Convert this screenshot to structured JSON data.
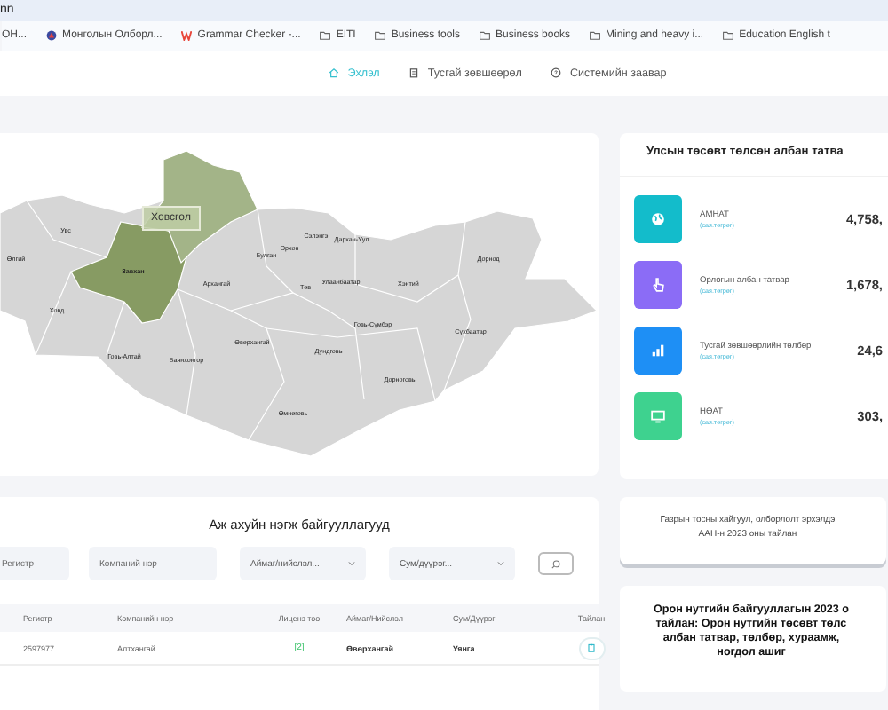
{
  "browser": {
    "address": "nn",
    "bookmarks": [
      {
        "label": "ОН..."
      },
      {
        "label": "Монголын Олборл..."
      },
      {
        "label": "Grammar Checker -..."
      },
      {
        "label": "EITI"
      },
      {
        "label": "Business tools"
      },
      {
        "label": "Business books"
      },
      {
        "label": "Mining and heavy i..."
      },
      {
        "label": "Education English t"
      }
    ]
  },
  "nav": [
    {
      "label": "Эхлэл",
      "selected": true
    },
    {
      "label": "Тусгай зөвшөөрөл",
      "selected": false
    },
    {
      "label": "Системийн заавар",
      "selected": false
    }
  ],
  "map": {
    "tooltip": "Хөвсгөл",
    "regions": [
      {
        "name": "Увс",
        "selected": false
      },
      {
        "name": "Өлгий",
        "selected": false
      },
      {
        "name": "Ховд",
        "selected": false
      },
      {
        "name": "Завхан",
        "selected": true
      },
      {
        "name": "Булган",
        "selected": false
      },
      {
        "name": "Орхон",
        "selected": false
      },
      {
        "name": "Сэлэнгэ",
        "selected": false
      },
      {
        "name": "Дархан-Уул",
        "selected": false
      },
      {
        "name": "Архангай",
        "selected": false
      },
      {
        "name": "Төв",
        "selected": false
      },
      {
        "name": "Улаанбаатар",
        "selected": false
      },
      {
        "name": "Хэнтий",
        "selected": false
      },
      {
        "name": "Дорнод",
        "selected": false
      },
      {
        "name": "Говь-Сүмбэр",
        "selected": false
      },
      {
        "name": "Сүхбаатар",
        "selected": false
      },
      {
        "name": "Өвөрхангай",
        "selected": false
      },
      {
        "name": "Дундговь",
        "selected": false
      },
      {
        "name": "Говь-Алтай",
        "selected": false
      },
      {
        "name": "Баянхонгор",
        "selected": false
      },
      {
        "name": "Дорноговь",
        "selected": false
      },
      {
        "name": "Өмнөговь",
        "selected": false
      }
    ]
  },
  "taxes": {
    "title": "Улсын төсөвт төлсөн албан татва",
    "items": [
      {
        "label": "АМНАТ",
        "unit": "(сая.төгрөг)",
        "value": "4,758,",
        "color": "#13bccb"
      },
      {
        "label": "Орлогын албан татвар",
        "unit": "(сая.төгрөг)",
        "value": "1,678,",
        "color": "#8b6cf6"
      },
      {
        "label": "Тусгай зөвшөөрлийн төлбөр",
        "unit": "(сая.төгрөг)",
        "value": "24,6",
        "color": "#1e8ff5"
      },
      {
        "label": "НӨАТ",
        "unit": "(сая.төгрөг)",
        "value": "303,",
        "color": "#3ed28f"
      }
    ]
  },
  "companies": {
    "title": "Аж ахуйн нэгж байгууллагууд",
    "filters": [
      {
        "kind": "input",
        "placeholder": "Регистр"
      },
      {
        "kind": "input",
        "placeholder": "Компаний нэр"
      },
      {
        "kind": "select",
        "placeholder": "Аймаг/нийслэл..."
      },
      {
        "kind": "select",
        "placeholder": "Сум/дүүрэг..."
      }
    ],
    "columns": [
      "Регистр",
      "Компанийн нэр",
      "Лиценз тоо",
      "Аймаг/Нийслэл",
      "Сум/Дүүрэг",
      "Тайлан"
    ],
    "rows": [
      {
        "register": "2597977",
        "name": "Алтхангай",
        "licenses": "[2]",
        "province": "Өвөрхангай",
        "district": "Уянга"
      }
    ]
  },
  "reports": [
    {
      "lines": [
        "Газрын тосны хайгуул, олборлолт эрхэлдэ",
        "ААН-н 2023 оны тайлан"
      ]
    },
    {
      "lines": [
        "Орон нутгийн байгууллагын 2023 о",
        "тайлан: Орон нутгийн төсөвт төлс",
        "албан татвар, төлбөр, хураамж,",
        "ногдол ашиг"
      ]
    }
  ]
}
